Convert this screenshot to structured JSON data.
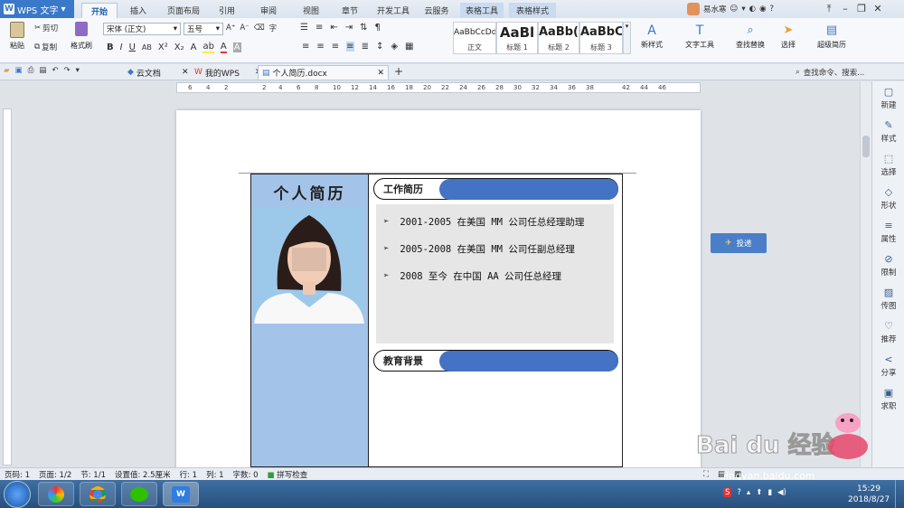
{
  "app": {
    "menu_label": "WPS 文字"
  },
  "ribbon_tabs": [
    "开始",
    "插入",
    "页面布局",
    "引用",
    "审阅",
    "视图",
    "章节",
    "开发工具",
    "云服务",
    "表格工具",
    "表格样式"
  ],
  "user": {
    "name": "易水寒"
  },
  "ribbon": {
    "paste": "粘贴",
    "cut": "剪切",
    "copy": "复制",
    "format_painter": "格式刷",
    "font": "宋体 (正文)",
    "size": "五号",
    "styles": [
      {
        "preview": "AaBbCcDd",
        "caption": "正文"
      },
      {
        "preview": "AaBl",
        "caption": "标题 1"
      },
      {
        "preview": "AaBb(",
        "caption": "标题 2"
      },
      {
        "preview": "AaBbC",
        "caption": "标题 3"
      }
    ],
    "new_style": "新样式",
    "text_tools": "文字工具",
    "find_replace": "查找替换",
    "select": "选择",
    "super_resume": "超级简历"
  },
  "doc_tabs": [
    {
      "label": "云文档"
    },
    {
      "label": "我的WPS"
    },
    {
      "label": "个人简历.docx"
    }
  ],
  "search": {
    "placeholder": "查找命令、搜索..."
  },
  "ruler_numbers": [
    "6",
    "4",
    "2",
    "2",
    "4",
    "6",
    "8",
    "10",
    "12",
    "14",
    "16",
    "18",
    "20",
    "22",
    "24",
    "26",
    "28",
    "30",
    "32",
    "34",
    "36",
    "38",
    "42",
    "44",
    "46"
  ],
  "resume": {
    "title": "个人简历",
    "work_heading": "工作简历",
    "jobs": [
      "2001-2005  在美国 MM 公司任总经理助理",
      "2005-2008  在美国 MM 公司任副总经理",
      "2008 至今  在中国 AA 公司任总经理"
    ],
    "edu_heading": "教育背景"
  },
  "float_button": "投递",
  "sidebar": [
    "新建",
    "样式",
    "选择",
    "形状",
    "属性",
    "限制",
    "传图",
    "推荐",
    "分享",
    "求职"
  ],
  "status": {
    "page": "页码: 1",
    "pages": "页面: 1/2",
    "section": "节: 1/1",
    "setting": "设置值: 2.5厘米",
    "row": "行: 1",
    "col": "列: 1",
    "words": "字数: 0",
    "spell": "拼写检查"
  },
  "clock": {
    "time": "15:29",
    "date": "2018/8/27"
  },
  "watermark": "jingyan.baidu.com",
  "colors": {
    "accent": "#4472c4",
    "photo_bg": "#a4c3e8",
    "titlebar": "#3a78c9"
  }
}
